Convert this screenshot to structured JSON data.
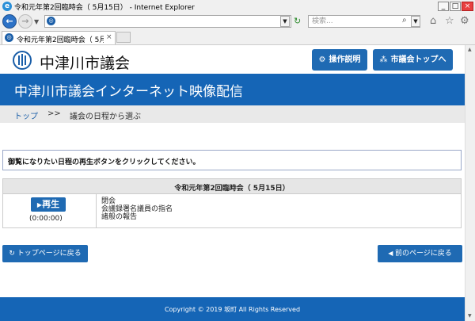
{
  "window": {
    "title": "令和元年第2回臨時会（ 5月15日） - Internet Explorer",
    "min_glyph": "_",
    "max_glyph": "□",
    "close_glyph": "×"
  },
  "address_bar": {
    "url": "",
    "search_placeholder": "検索..."
  },
  "tabs": [
    {
      "label": "令和元年第2回臨時会（ 5月...",
      "close": "×"
    }
  ],
  "site": {
    "name": "中津川市議会",
    "help_button": "操作説明",
    "home_button": "市議会トップへ",
    "banner_title": "中津川市議会インターネット映像配信"
  },
  "breadcrumb": {
    "top": "トップ",
    "separator": ">>",
    "current": "議会の日程から選ぶ"
  },
  "instruction": "御覧になりたい日程の再生ボタンをクリックしてください。",
  "schedule": {
    "header": "令和元年第2回臨時会（ 5月15日）",
    "play_label": "再生",
    "duration": "(0:00:00)",
    "agenda": [
      "閉会",
      "会議録署名議員の指名",
      "諸般の報告"
    ]
  },
  "nav": {
    "back_to_top": "トップページに戻る",
    "prev_page": "前のページに戻る"
  },
  "footer": {
    "copyright": "Copyright © 2019 坂町 All Rights Reserved"
  },
  "colors": {
    "brand_blue": "#1565b6",
    "button_blue": "#1f6ab3"
  }
}
